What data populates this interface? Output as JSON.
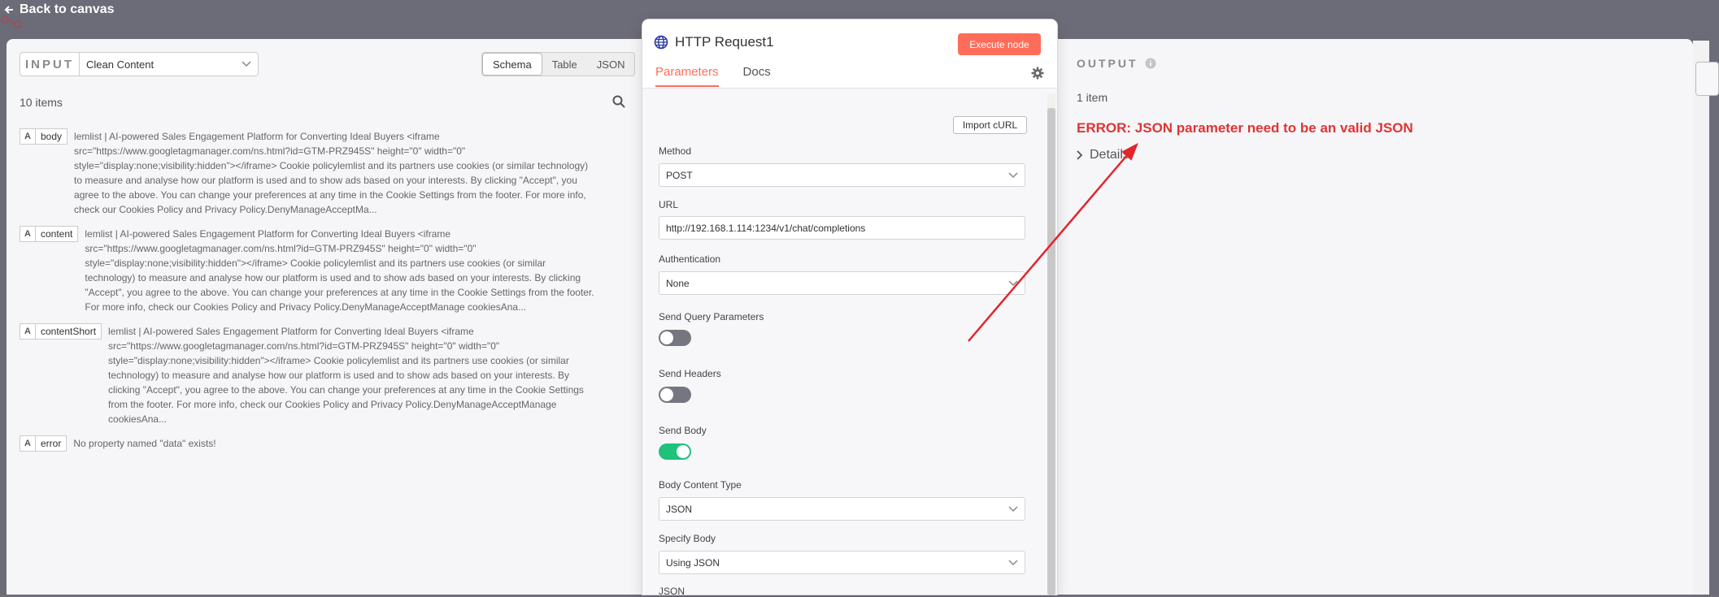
{
  "nav": {
    "back_label": "Back to canvas"
  },
  "input": {
    "label": "INPUT",
    "selected_node": "Clean Content",
    "view_tabs": [
      "Schema",
      "Table",
      "JSON"
    ],
    "active_tab": "Schema",
    "items_count": "10 items",
    "rows": [
      {
        "type": "A",
        "key": "body",
        "lines": [
          "lemlist | AI-powered Sales Engagement Platform for Converting Ideal Buyers <iframe",
          "src=\"https://www.googletagmanager.com/ns.html?id=GTM-PRZ945S\" height=\"0\" width=\"0\"",
          "style=\"display:none;visibility:hidden\"></iframe> Cookie policylemlist and its partners use cookies (or similar technology)",
          "to measure and analyse how our platform is used and to show ads based on your interests. By clicking \"Accept\", you",
          "agree to the above. You can change your preferences at any time in the Cookie Settings from the footer. For more info,",
          "check our Cookies Policy and Privacy Policy.DenyManageAcceptMa..."
        ]
      },
      {
        "type": "A",
        "key": "content",
        "lines": [
          "lemlist | AI-powered Sales Engagement Platform for Converting Ideal Buyers <iframe",
          "src=\"https://www.googletagmanager.com/ns.html?id=GTM-PRZ945S\" height=\"0\" width=\"0\"",
          "style=\"display:none;visibility:hidden\"></iframe> Cookie policylemlist and its partners use cookies (or similar",
          "technology) to measure and analyse how our platform is used and to show ads based on your interests. By clicking",
          "\"Accept\", you agree to the above. You can change your preferences at any time in the Cookie Settings from the footer.",
          "For more info, check our Cookies Policy and Privacy Policy.DenyManageAcceptManage cookiesAna..."
        ]
      },
      {
        "type": "A",
        "key": "contentShort",
        "lines": [
          "lemlist | AI-powered Sales Engagement Platform for Converting Ideal Buyers <iframe",
          "src=\"https://www.googletagmanager.com/ns.html?id=GTM-PRZ945S\" height=\"0\" width=\"0\"",
          "style=\"display:none;visibility:hidden\"></iframe> Cookie policylemlist and its partners use cookies (or similar",
          "technology) to measure and analyse how our platform is used and to show ads based on your interests. By",
          "clicking \"Accept\", you agree to the above. You can change your preferences at any time in the Cookie Settings",
          "from the footer. For more info, check our Cookies Policy and Privacy Policy.DenyManageAcceptManage",
          "cookiesAna..."
        ]
      },
      {
        "type": "A",
        "key": "error",
        "lines": [
          "No property named \"data\" exists!"
        ]
      }
    ]
  },
  "node": {
    "title": "HTTP Request1",
    "execute_label": "Execute node",
    "tabs": [
      "Parameters",
      "Docs"
    ],
    "import_curl_label": "Import cURL",
    "method_label": "Method",
    "method_value": "POST",
    "url_label": "URL",
    "url_value": "http://192.168.1.114:1234/v1/chat/completions",
    "auth_label": "Authentication",
    "auth_value": "None",
    "send_query_label": "Send Query Parameters",
    "send_query_on": false,
    "send_headers_label": "Send Headers",
    "send_headers_on": false,
    "send_body_label": "Send Body",
    "send_body_on": true,
    "body_type_label": "Body Content Type",
    "body_type_value": "JSON",
    "specify_body_label": "Specify Body",
    "specify_body_value": "Using JSON",
    "json_label": "JSON"
  },
  "output": {
    "label": "OUTPUT",
    "items_count": "1 item",
    "error_message": "ERROR: JSON parameter need to be an valid JSON",
    "details_label": "Details"
  },
  "colors": {
    "accent": "#ff6d5a",
    "error": "#e03434",
    "toggle_on": "#1ec27a",
    "annotation_arrow": "#e3242b"
  }
}
